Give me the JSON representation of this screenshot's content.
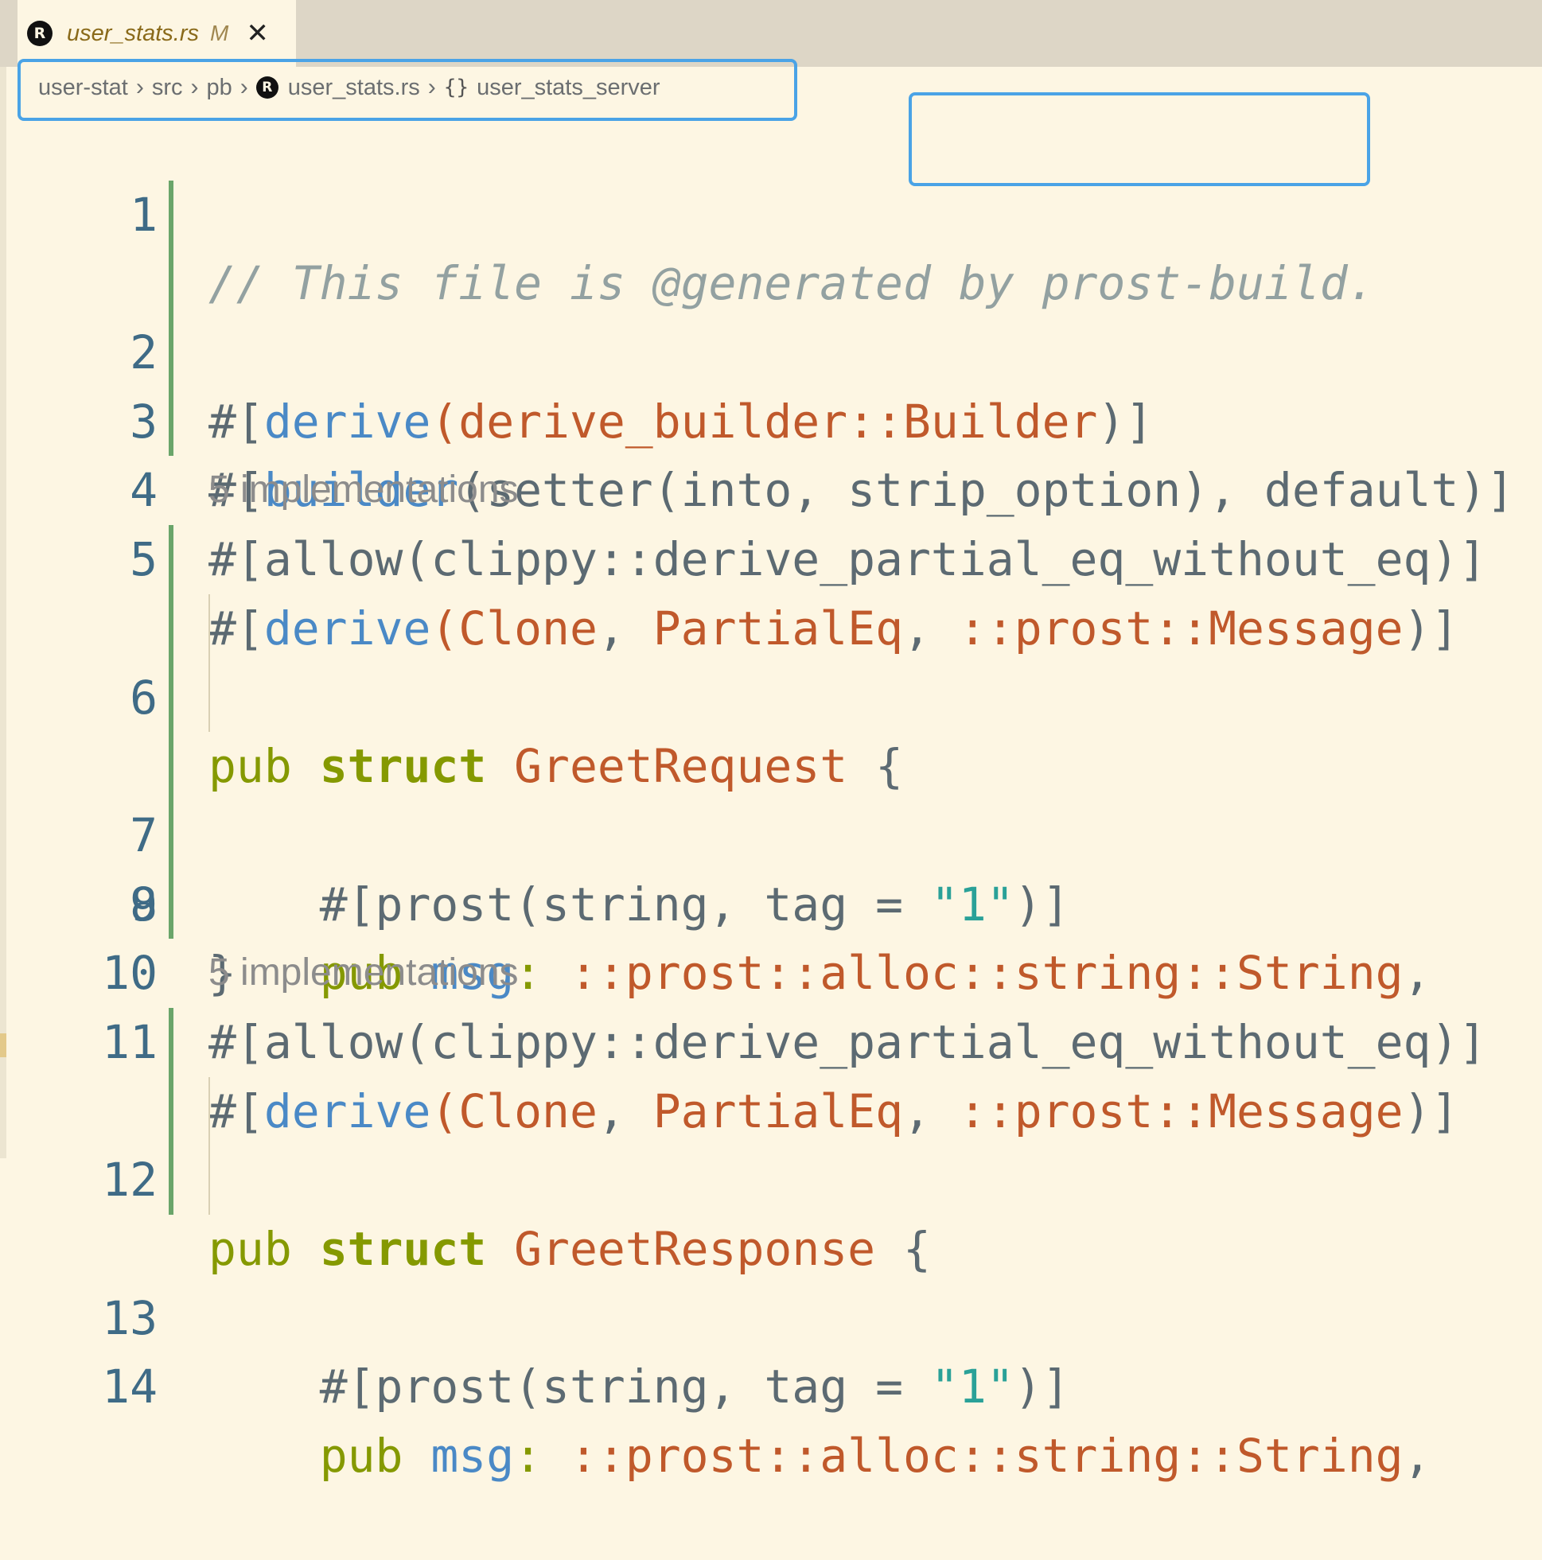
{
  "tab": {
    "icon": "rust-icon",
    "filename": "user_stats.rs",
    "status": "M",
    "close_glyph": "✕"
  },
  "breadcrumb": {
    "segments": [
      "user-stat",
      "src",
      "pb",
      "user_stats.rs",
      "user_stats_server"
    ],
    "separator": "›",
    "braces": "{}"
  },
  "editor": {
    "lines": [
      {
        "num": "1"
      },
      {
        "num": "2"
      },
      {
        "num": "3"
      },
      {
        "num": "4"
      },
      {
        "num": "5"
      },
      {
        "num": "6"
      },
      {
        "num": "7"
      },
      {
        "num": "8"
      },
      {
        "num": "9"
      },
      {
        "num": "10"
      },
      {
        "num": "11"
      },
      {
        "num": "12"
      },
      {
        "num": "13"
      },
      {
        "num": "14"
      }
    ],
    "code_lens_1": "5 implementations",
    "code_lens_2": "5 implementations",
    "tokens": {
      "l1_comment": "// This file is @generated by prost-build.",
      "derive": "derive",
      "builder_path": "derive_builder::Builder",
      "builder": "builder",
      "builder_args": "setter(into, strip_option), default",
      "allow_line": "#[allow(clippy::derive_partial_eq_without_eq)]",
      "clone": "Clone",
      "partialeq": "PartialEq",
      "prost_message": "::prost::Message",
      "pub": "pub",
      "struct": "struct",
      "greet_request": "GreetRequest",
      "greet_response": "GreetResponse",
      "prost_attr": "#[prost(string, tag = ",
      "tag_value": "\"1\"",
      "msg": "msg",
      "string_path": "::prost::alloc::string::String",
      "close_brace": "}",
      "open_brace": "{"
    }
  },
  "colors": {
    "background": "#fdf6e3",
    "tab_bar": "#ddd6c6",
    "focus_outline": "#4aa3e6",
    "git_gutter": "#6aa56a"
  }
}
